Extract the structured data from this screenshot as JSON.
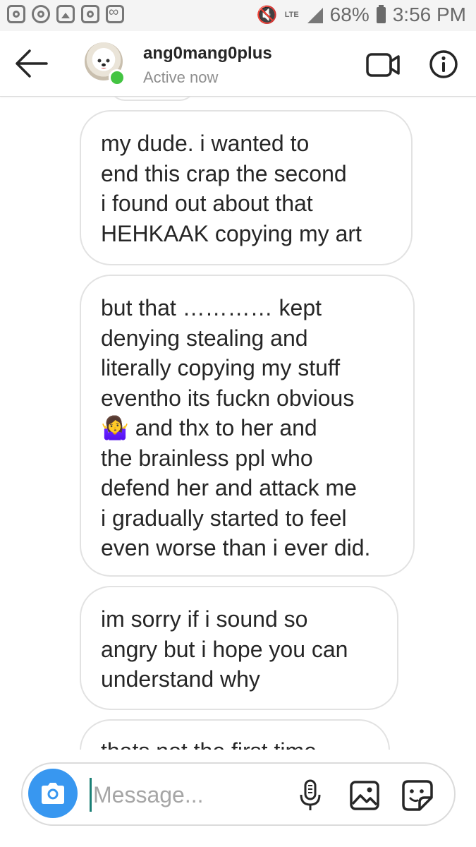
{
  "status_bar": {
    "network": "LTE",
    "battery": "68%",
    "time": "3:56 PM",
    "left_icons": [
      "instagram-icon",
      "dribbble-icon",
      "gallery-icon",
      "instagram-icon",
      "voicemail-icon"
    ]
  },
  "header": {
    "username": "ang0mang0plus",
    "status": "Active now"
  },
  "messages": [
    {
      "text": "my dude. i wanted to\nend this crap the second\ni found out about that\nHEHKAAK copying my  art"
    },
    {
      "text": "but that ………… kept\ndenying stealing and\nliterally copying my stuff\neventho its fuckn obvious\n🤷‍♀️ and thx to her and\nthe brainless ppl who\ndefend her and attack me\ni gradually started to feel\neven worse than i ever did."
    },
    {
      "text": "im sorry if i sound so\nangry but i hope you can\nunderstand why"
    },
    {
      "text": "thats not the first time"
    }
  ],
  "composer": {
    "placeholder": "Message..."
  },
  "colors": {
    "accent": "#3897f0",
    "online": "#43c442",
    "bubble_border": "#e2e2e2"
  }
}
